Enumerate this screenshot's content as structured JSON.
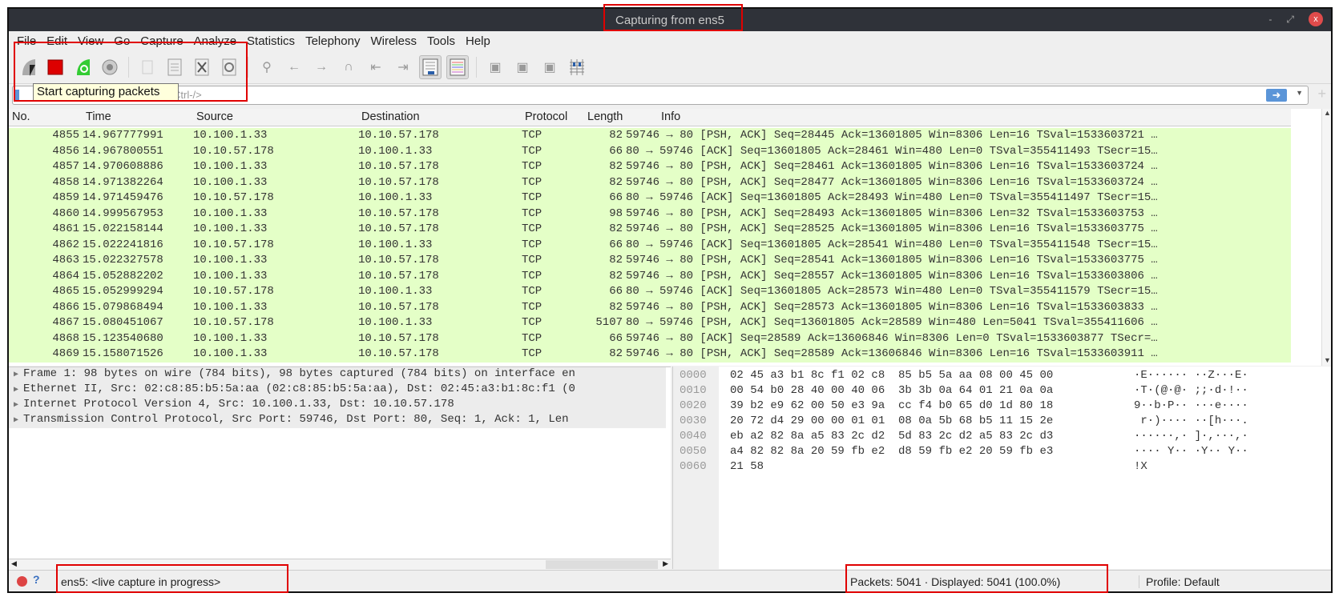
{
  "window": {
    "title": "Capturing from ens5",
    "minimize": "-",
    "maximize": "⤢",
    "close": "x"
  },
  "menu": [
    "File",
    "Edit",
    "View",
    "Go",
    "Capture",
    "Analyze",
    "Statistics",
    "Telephony",
    "Wireless",
    "Tools",
    "Help"
  ],
  "toolbar": {
    "tooltip": "Start capturing packets",
    "icons": [
      "start-capture",
      "stop-capture",
      "restart-capture",
      "capture-options",
      "open-file",
      "save-file",
      "close-file",
      "reload-file",
      "find-packet",
      "go-back",
      "go-forward",
      "go-to-packet",
      "first-packet",
      "last-packet",
      "autoscroll",
      "colorize",
      "zoom-in",
      "zoom-out",
      "normal-size",
      "resize-columns"
    ]
  },
  "filter": {
    "placeholder": "Ctrl-/>",
    "apply_icon": "arrow-right"
  },
  "columns": [
    "No.",
    "Time",
    "Source",
    "Destination",
    "Protocol",
    "Length",
    "Info"
  ],
  "packets": [
    [
      "4855",
      "14.967777991",
      "10.100.1.33",
      "10.10.57.178",
      "TCP",
      "82",
      "59746 → 80 [PSH, ACK] Seq=28445 Ack=13601805 Win=8306 Len=16 TSval=1533603721 …"
    ],
    [
      "4856",
      "14.967800551",
      "10.10.57.178",
      "10.100.1.33",
      "TCP",
      "66",
      "80 → 59746 [ACK] Seq=13601805 Ack=28461 Win=480 Len=0 TSval=355411493 TSecr=15…"
    ],
    [
      "4857",
      "14.970608886",
      "10.100.1.33",
      "10.10.57.178",
      "TCP",
      "82",
      "59746 → 80 [PSH, ACK] Seq=28461 Ack=13601805 Win=8306 Len=16 TSval=1533603724 …"
    ],
    [
      "4858",
      "14.971382264",
      "10.100.1.33",
      "10.10.57.178",
      "TCP",
      "82",
      "59746 → 80 [PSH, ACK] Seq=28477 Ack=13601805 Win=8306 Len=16 TSval=1533603724 …"
    ],
    [
      "4859",
      "14.971459476",
      "10.10.57.178",
      "10.100.1.33",
      "TCP",
      "66",
      "80 → 59746 [ACK] Seq=13601805 Ack=28493 Win=480 Len=0 TSval=355411497 TSecr=15…"
    ],
    [
      "4860",
      "14.999567953",
      "10.100.1.33",
      "10.10.57.178",
      "TCP",
      "98",
      "59746 → 80 [PSH, ACK] Seq=28493 Ack=13601805 Win=8306 Len=32 TSval=1533603753 …"
    ],
    [
      "4861",
      "15.022158144",
      "10.100.1.33",
      "10.10.57.178",
      "TCP",
      "82",
      "59746 → 80 [PSH, ACK] Seq=28525 Ack=13601805 Win=8306 Len=16 TSval=1533603775 …"
    ],
    [
      "4862",
      "15.022241816",
      "10.10.57.178",
      "10.100.1.33",
      "TCP",
      "66",
      "80 → 59746 [ACK] Seq=13601805 Ack=28541 Win=480 Len=0 TSval=355411548 TSecr=15…"
    ],
    [
      "4863",
      "15.022327578",
      "10.100.1.33",
      "10.10.57.178",
      "TCP",
      "82",
      "59746 → 80 [PSH, ACK] Seq=28541 Ack=13601805 Win=8306 Len=16 TSval=1533603775 …"
    ],
    [
      "4864",
      "15.052882202",
      "10.100.1.33",
      "10.10.57.178",
      "TCP",
      "82",
      "59746 → 80 [PSH, ACK] Seq=28557 Ack=13601805 Win=8306 Len=16 TSval=1533603806 …"
    ],
    [
      "4865",
      "15.052999294",
      "10.10.57.178",
      "10.100.1.33",
      "TCP",
      "66",
      "80 → 59746 [ACK] Seq=13601805 Ack=28573 Win=480 Len=0 TSval=355411579 TSecr=15…"
    ],
    [
      "4866",
      "15.079868494",
      "10.100.1.33",
      "10.10.57.178",
      "TCP",
      "82",
      "59746 → 80 [PSH, ACK] Seq=28573 Ack=13601805 Win=8306 Len=16 TSval=1533603833 …"
    ],
    [
      "4867",
      "15.080451067",
      "10.10.57.178",
      "10.100.1.33",
      "TCP",
      "5107",
      "80 → 59746 [PSH, ACK] Seq=13601805 Ack=28589 Win=480 Len=5041 TSval=355411606 …"
    ],
    [
      "4868",
      "15.123540680",
      "10.100.1.33",
      "10.10.57.178",
      "TCP",
      "66",
      "59746 → 80 [ACK] Seq=28589 Ack=13606846 Win=8306 Len=0 TSval=1533603877 TSecr=…"
    ],
    [
      "4869",
      "15.158071526",
      "10.100.1.33",
      "10.10.57.178",
      "TCP",
      "82",
      "59746 → 80 [PSH, ACK] Seq=28589 Ack=13606846 Win=8306 Len=16 TSval=1533603911 …"
    ]
  ],
  "details": [
    "Frame 1: 98 bytes on wire (784 bits), 98 bytes captured (784 bits) on interface en",
    "Ethernet II, Src: 02:c8:85:b5:5a:aa (02:c8:85:b5:5a:aa), Dst: 02:45:a3:b1:8c:f1 (0",
    "Internet Protocol Version 4, Src: 10.100.1.33, Dst: 10.10.57.178",
    "Transmission Control Protocol, Src Port: 59746, Dst Port: 80, Seq: 1, Ack: 1, Len"
  ],
  "hex": [
    [
      "0000",
      "02 45 a3 b1 8c f1 02 c8  85 b5 5a aa 08 00 45 00",
      "·E······ ··Z···E·"
    ],
    [
      "0010",
      "00 54 b0 28 40 00 40 06  3b 3b 0a 64 01 21 0a 0a",
      "·T·(@·@· ;;·d·!··"
    ],
    [
      "0020",
      "39 b2 e9 62 00 50 e3 9a  cc f4 b0 65 d0 1d 80 18",
      "9··b·P·· ···e····"
    ],
    [
      "0030",
      "20 72 d4 29 00 00 01 01  08 0a 5b 68 b5 11 15 2e",
      " r·)···· ··[h···."
    ],
    [
      "0040",
      "eb a2 82 8a a5 83 2c d2  5d 83 2c d2 a5 83 2c d3",
      "······,· ]·,···,·"
    ],
    [
      "0050",
      "a4 82 82 8a 20 59 fb e2  d8 59 fb e2 20 59 fb e3",
      "···· Y·· ·Y·· Y··"
    ],
    [
      "0060",
      "21 58",
      "!X"
    ]
  ],
  "status": {
    "interface": "ens5: <live capture in progress>",
    "packets": "Packets: 5041 · Displayed: 5041 (100.0%)",
    "profile": "Profile: Default"
  },
  "colors": {
    "row_bg": "#e4ffc7",
    "annotation": "#e00000",
    "titlebar": "#2f3239"
  }
}
